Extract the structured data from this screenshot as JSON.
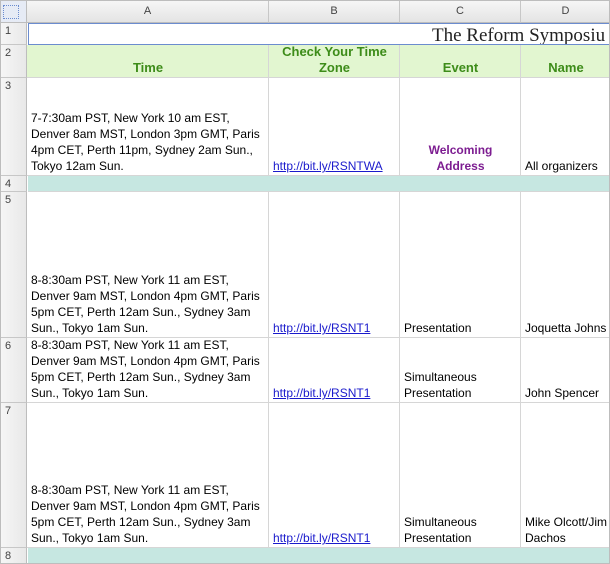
{
  "columns": [
    "A",
    "B",
    "C",
    "D"
  ],
  "rows": [
    "1",
    "2",
    "3",
    "4",
    "5",
    "6",
    "7",
    "8"
  ],
  "title": "The Reform Symposiu",
  "headers": {
    "time": "Time",
    "check_tz": "Check Your Time Zone",
    "event": "Event",
    "name": "Name"
  },
  "sessions": [
    {
      "time": "7-7:30am PST, New York 10 am EST, Denver 8am MST, London 3pm GMT, Paris 4pm CET, Perth 11pm, Sydney 2am Sun., Tokyo 12am Sun.",
      "link": "http://bit.ly/RSNTWA",
      "event": "Welcoming Address",
      "name": "All organizers"
    },
    {
      "time": "8-8:30am PST, New York 11 am EST, Denver 9am MST, London 4pm GMT, Paris 5pm CET, Perth 12am Sun., Sydney 3am Sun., Tokyo 1am Sun.",
      "link": "http://bit.ly/RSNT1",
      "event": "Presentation",
      "name": "Joquetta Johns"
    },
    {
      "time": "8-8:30am PST, New York 11 am EST, Denver 9am MST, London 4pm GMT, Paris 5pm CET, Perth 12am Sun., Sydney 3am Sun., Tokyo 1am Sun.",
      "link": "http://bit.ly/RSNT1",
      "event": "Simultaneous Presentation",
      "name": "John Spencer"
    },
    {
      "time": "8-8:30am PST, New York 11 am EST, Denver 9am MST, London 4pm GMT, Paris 5pm CET, Perth 12am Sun., Sydney 3am Sun., Tokyo 1am Sun.",
      "link": "http://bit.ly/RSNT1",
      "event": "Simultaneous Presentation",
      "name": "Mike Olcott/Jim Dachos"
    }
  ],
  "colors": {
    "header_fill": "#e2f6d0",
    "header_text": "#3d8c19",
    "separator_fill": "#c6e7e1",
    "event_highlight": "#7d1d91",
    "link": "#1a1acc"
  }
}
